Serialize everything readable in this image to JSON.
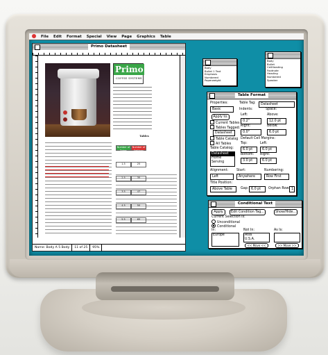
{
  "menubar": {
    "items": [
      "File",
      "Edit",
      "Format",
      "Special",
      "View",
      "Page",
      "Graphics",
      "Table"
    ]
  },
  "document": {
    "title": "Primo Datasheet",
    "logo": {
      "word": "Primo",
      "tagline": "COFFEE SYSTEMS"
    },
    "table": {
      "title": "Tables",
      "header": [
        "Number of Tubes",
        "Number of Settings"
      ],
      "rows": [
        [
          "1.5",
          "25"
        ],
        [
          "2.5",
          "35"
        ],
        [
          "3.5",
          "47"
        ],
        [
          "4.5",
          "50"
        ],
        [
          "5.5",
          "65"
        ]
      ]
    },
    "status": {
      "page_style": "Name: Body A 5 Body",
      "page": "11 of 25",
      "zoom": "95%"
    }
  },
  "catalog_left": {
    "items": [
      "Body",
      "Bullet 1 Text",
      "Emphasis",
      "Numbered",
      "Paperweight"
    ]
  },
  "catalog_right": {
    "items": [
      "Body",
      "Bullet",
      "CellHeading",
      "Footnote",
      "Heading",
      "Numbered",
      "Speaker"
    ]
  },
  "table_format": {
    "title": "Table Format",
    "properties_label": "Properties:",
    "properties_value": "Basic",
    "table_tag_label": "Table Tag:",
    "table_tag_value": "Datasheet",
    "apply_button": "Apply to:",
    "apply_options": [
      "Current Tables",
      "Tables Tagged:"
    ],
    "apply_tag_value": "Datasheet",
    "catalog_options": [
      "Table Catalog",
      "All Tables"
    ],
    "indents_label": "Indents:",
    "left_label": "Left:",
    "left_value": "0.2\"",
    "right_label": "Right:",
    "right_value": "0.0\"",
    "spacing_label": "Space:",
    "above_label": "Above:",
    "above_value": "12.0 pt",
    "below_label": "Below:",
    "below_value": "6.0 pt",
    "alignment_label": "Alignment:",
    "alignment_value": "Left",
    "start_label": "Start:",
    "start_value": "Anywhere",
    "numbering_label": "Numbering:",
    "numbering_value": "Row First",
    "catalog_label": "Table Catalog:",
    "catalog_items": [
      "Datasheet",
      "Home",
      "Serving"
    ],
    "cell_margins_label": "Default Cell Margins:",
    "top_label": "Top:",
    "top_value": "6.0 pt",
    "bottom_label": "Bottom:",
    "bottom_value": "3.0 pt",
    "cleft_label": "Left:",
    "cleft_value": "6.0 pt",
    "cright_label": "Right:",
    "cright_value": "6.0 pt",
    "title_pos_label": "Title Position:",
    "title_pos_value": "Above Table",
    "gap_label": "Gap:",
    "gap_value": "6.0 pt",
    "orphan_label": "Orphan Rows:",
    "orphan_value": "1"
  },
  "conditional_text": {
    "title": "Conditional Text",
    "apply_button": "Apply",
    "edit_button": "Edit Condition Tag...",
    "show_button": "Show/Hide...",
    "selection_label": "Current Selection Is:",
    "options": [
      "Unconditional",
      "Conditional"
    ],
    "in_label": "In:",
    "not_in_label": "Not In:",
    "as_is_label": "As Is:",
    "in_items": [
      "Europe"
    ],
    "not_in_items": [
      "Asia",
      "U.S.A."
    ],
    "move_left": "<< Move <<",
    "move_right": ">> Move >>"
  }
}
